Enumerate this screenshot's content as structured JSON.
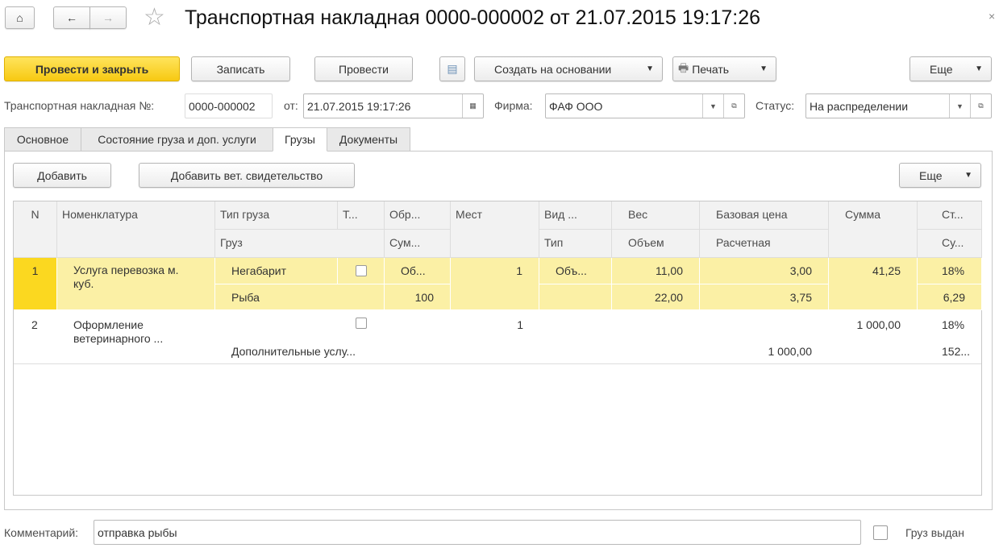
{
  "window": {
    "title": "Транспортная накладная 0000-000002 от 21.07.2015 19:17:26",
    "close": "×"
  },
  "toolbar": {
    "post_close": "Провести и закрыть",
    "save": "Записать",
    "post": "Провести",
    "create_based": "Создать на основании",
    "print": "Печать",
    "more": "Еще"
  },
  "header": {
    "number_label": "Транспортная накладная №:",
    "number": "0000-000002",
    "date_label": "от:",
    "date": "21.07.2015 19:17:26",
    "firm_label": "Фирма:",
    "firm": "ФАФ ООО",
    "status_label": "Статус:",
    "status": "На распределении"
  },
  "tabs": [
    "Основное",
    "Состояние груза и доп. услуги",
    "Грузы",
    "Документы"
  ],
  "cargo": {
    "add": "Добавить",
    "add_vet": "Добавить вет. свидетельство",
    "more": "Еще"
  },
  "table": {
    "headers": {
      "n": "N",
      "nom": "Номенклатура",
      "type": "Тип груза",
      "t": "Т...",
      "obr": "Обр...",
      "mest": "Мест",
      "vid": "Вид ...",
      "ves": "Вес",
      "base": "Базовая цена",
      "sum": "Сумма",
      "st": "Ст...",
      "cargo": "Груз",
      "summ": "Сум...",
      "tip": "Тип",
      "vol": "Объем",
      "calc": "Расчетная",
      "su": "Су..."
    },
    "rows": [
      {
        "n": "1",
        "nom": "Услуга перевозка м. куб.",
        "type": "Негабарит",
        "obr": "Об...",
        "mest": "1",
        "vid": "Объ...",
        "ves": "11,00",
        "base": "3,00",
        "sum": "41,25",
        "st": "18%",
        "cargo": "Рыба",
        "summ": "100",
        "vol": "22,00",
        "calc": "3,75",
        "su": "6,29"
      },
      {
        "n": "2",
        "nom": "Оформление ветеринарного ...",
        "mest": "1",
        "sum": "1 000,00",
        "st": "18%",
        "cargo": "Дополнительные услу...",
        "calc": "1 000,00",
        "su": "152..."
      }
    ]
  },
  "footer": {
    "comment_label": "Комментарий:",
    "comment": "отправка рыбы",
    "issued_label": "Груз выдан"
  }
}
